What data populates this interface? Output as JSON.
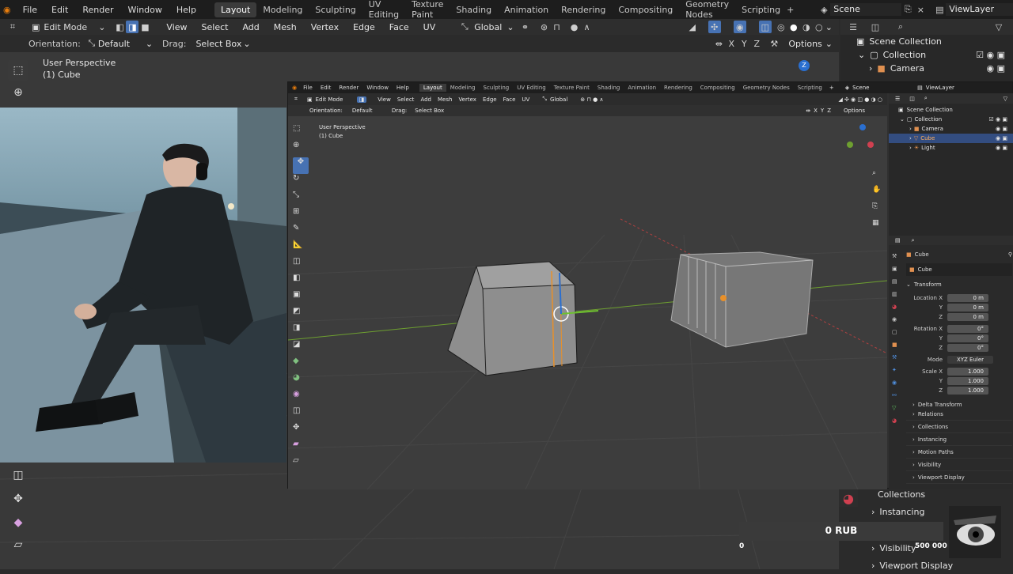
{
  "top_menu": [
    "File",
    "Edit",
    "Render",
    "Window",
    "Help"
  ],
  "workspaces": [
    "Layout",
    "Modeling",
    "Sculpting",
    "UV Editing",
    "Texture Paint",
    "Shading",
    "Animation",
    "Rendering",
    "Compositing",
    "Geometry Nodes",
    "Scripting"
  ],
  "active_workspace": "Layout",
  "scene_name": "Scene",
  "view_layer": "ViewLayer",
  "header": {
    "mode": "Edit Mode",
    "menus": [
      "View",
      "Select",
      "Add",
      "Mesh",
      "Vertex",
      "Edge",
      "Face",
      "UV"
    ],
    "transform_orientation": "Global",
    "axes": [
      "X",
      "Y",
      "Z"
    ],
    "options_label": "Options"
  },
  "tool_settings": {
    "orientation_label": "Orientation:",
    "orientation_value": "Default",
    "drag_label": "Drag:",
    "drag_value": "Select Box"
  },
  "viewport": {
    "title": "User Perspective",
    "subtitle": "(1) Cube"
  },
  "outliner": {
    "root": "Scene Collection",
    "collection": "Collection",
    "items": [
      "Camera",
      "Cube",
      "Light"
    ]
  },
  "properties": {
    "object_name": "Cube",
    "mesh_name": "Cube",
    "section_transform": "Transform",
    "location_label": "Location X",
    "location": [
      "0 m",
      "0 m",
      "0 m"
    ],
    "rotation_label": "Rotation X",
    "rotation": [
      "0°",
      "0°",
      "0°"
    ],
    "mode_label": "Mode",
    "mode_value": "XYZ Euler",
    "scale_label": "Scale X",
    "scale": [
      "1.000",
      "1.000",
      "1.000"
    ],
    "axis_y": "Y",
    "axis_z": "Z",
    "sections": [
      "Delta Transform",
      "Relations",
      "Collections",
      "Instancing",
      "Motion Paths",
      "Visibility",
      "Viewport Display"
    ]
  },
  "outer_panels": [
    "Collections",
    "Instancing",
    "Visibility",
    "Viewport Display"
  ],
  "donation": {
    "amount": "0 RUB",
    "min": "0",
    "max": "500 000",
    "progress": 0,
    "accent": "#3a3a3a"
  },
  "colors": {
    "accent": "#4772b3",
    "selected_row": "#334d80",
    "x_axis": "#c04040",
    "y_axis": "#6ea030",
    "edit_edge": "#e8902a"
  }
}
